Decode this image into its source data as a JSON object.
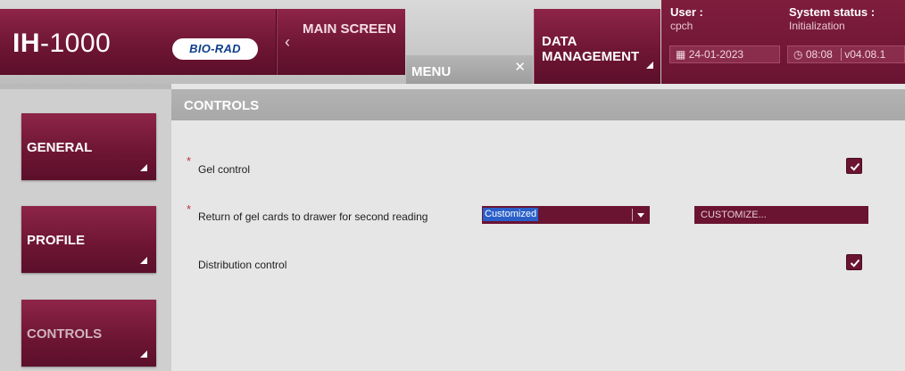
{
  "header": {
    "product_name_bold": "IH",
    "product_name_rest": "-1000",
    "brand_logo": "BIO-RAD",
    "main_screen": {
      "icon": "chevron-left-icon",
      "label": "MAIN SCREEN"
    },
    "menu_tab": {
      "label": "MENU",
      "close_icon": "close-icon"
    },
    "data_management": {
      "label": "DATA MANAGEMENT"
    },
    "status": {
      "user_label": "User :",
      "user_value": "cpch",
      "system_status_label": "System status :",
      "system_status_value": "Initialization",
      "date": "24-01-2023",
      "time": "08:08",
      "version": "v04.08.1"
    }
  },
  "sidebar": {
    "items": [
      {
        "label": "GENERAL"
      },
      {
        "label": "PROFILE"
      },
      {
        "label": "CONTROLS"
      }
    ]
  },
  "content": {
    "title": "CONTROLS",
    "settings": {
      "gel_control": {
        "label": "Gel control",
        "required_mark": "*",
        "checked": true
      },
      "return_cards": {
        "label": "Return of gel cards to drawer for second reading",
        "required_mark": "*",
        "selected": "Customized",
        "customize_button": "CUSTOMIZE..."
      },
      "distribution_control": {
        "label": "Distribution control",
        "checked": true
      }
    }
  },
  "colors": {
    "brand_maroon": "#6f1634",
    "panel_gray": "#e6e6e6",
    "selection_blue": "#2a5fc9"
  }
}
